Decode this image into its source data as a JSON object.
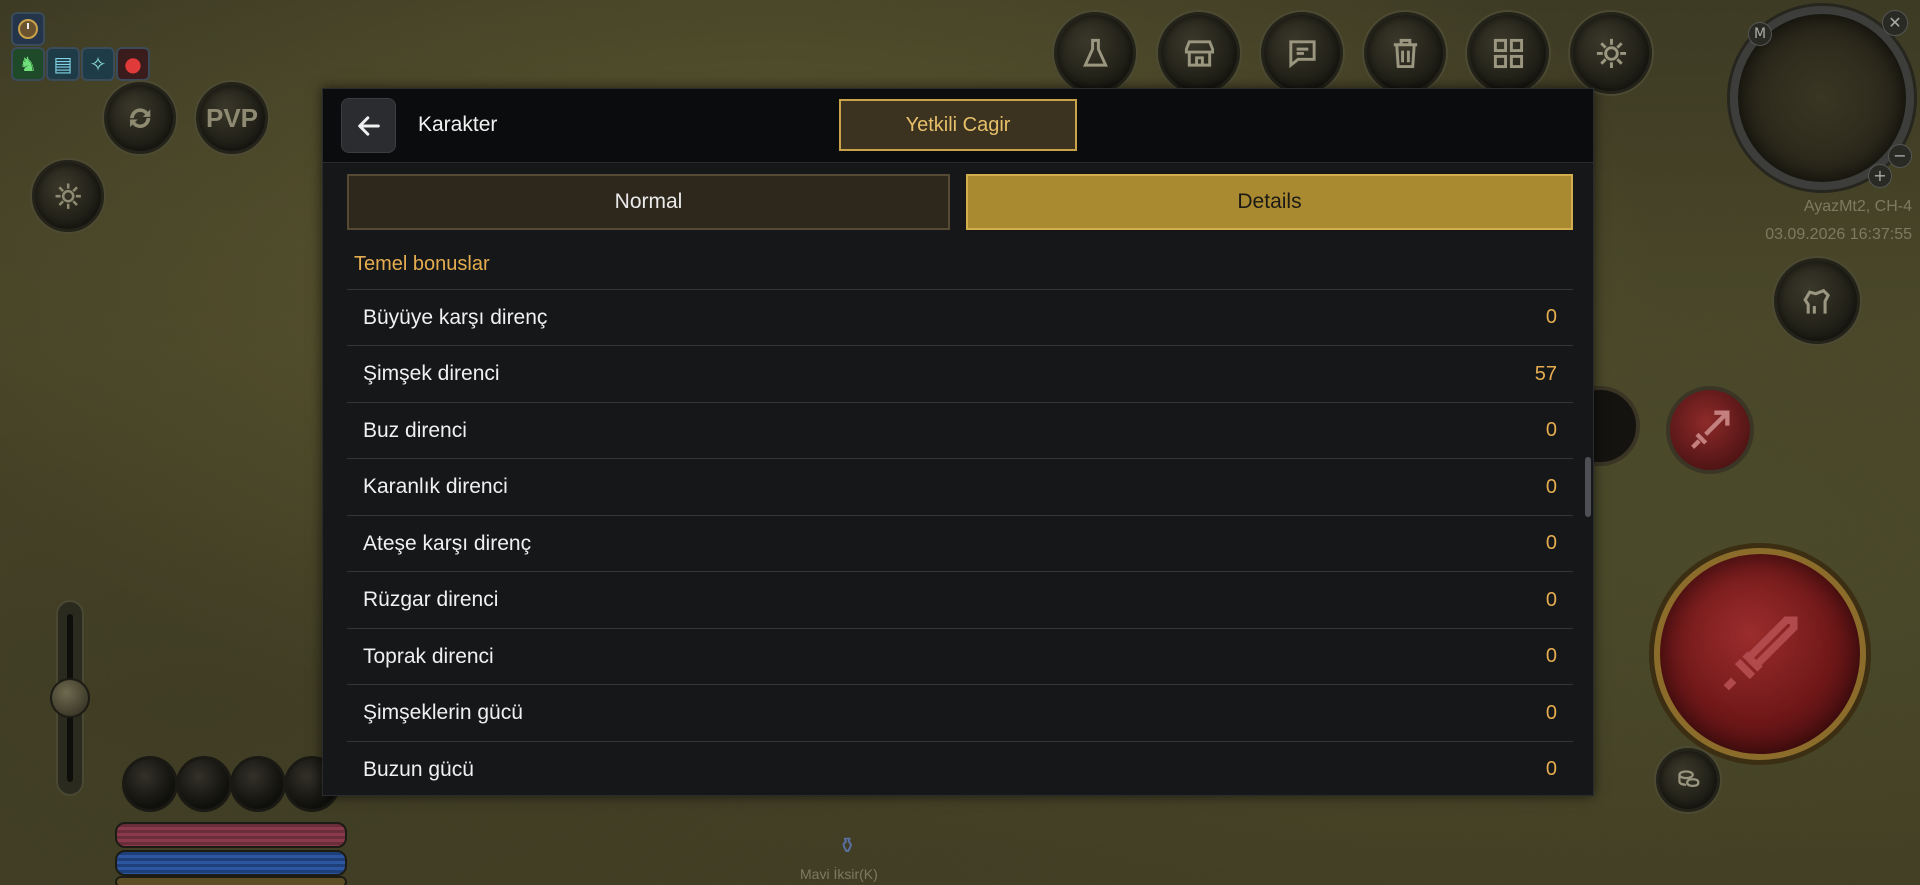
{
  "hud": {
    "pvp_label": "PVP",
    "server": "AyazMt2, CH-4",
    "datetime": "03.09.2026 16:37:55",
    "bottom_item": "Mavi İksir(K)",
    "buffs": [
      "clock-buff-icon",
      "horse-buff-icon",
      "scroll-buff-icon",
      "skill-buff-icon",
      "potion-buff-icon"
    ],
    "top_buttons": [
      "flask-icon",
      "shop-icon",
      "chat-icon",
      "trash-icon",
      "grid-icon",
      "gear-icon"
    ],
    "minimap_labels": {
      "m": "M",
      "plus": "+",
      "minus": "−"
    }
  },
  "panel": {
    "back_icon": "arrow-left-icon",
    "title": "Karakter",
    "gm_button": "Yetkili Cagir",
    "tabs": {
      "normal": "Normal",
      "details": "Details"
    },
    "section_title": "Temel bonuslar",
    "rows": [
      {
        "label": "Büyüye karşı direnç",
        "value": "0"
      },
      {
        "label": "Şimşek direnci",
        "value": "57"
      },
      {
        "label": "Buz direnci",
        "value": "0"
      },
      {
        "label": "Karanlık direnci",
        "value": "0"
      },
      {
        "label": "Ateşe karşı direnç",
        "value": "0"
      },
      {
        "label": "Rüzgar direnci",
        "value": "0"
      },
      {
        "label": "Toprak direnci",
        "value": "0"
      },
      {
        "label": "Şimşeklerin gücü",
        "value": "0"
      },
      {
        "label": "Buzun gücü",
        "value": "0"
      }
    ]
  },
  "colors": {
    "accent_gold": "#e5ad4f",
    "tab_active": "#a98a30",
    "attack_red": "#9b2c2c"
  }
}
